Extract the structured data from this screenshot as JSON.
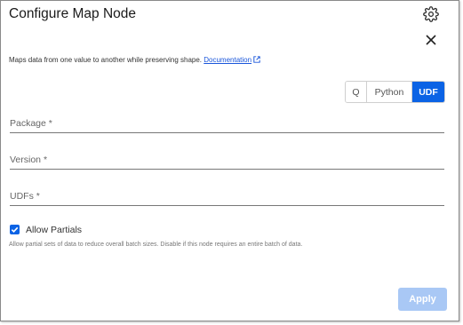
{
  "dialog": {
    "title": "Configure Map Node",
    "description": "Maps data from one value to another while preserving shape.",
    "doc_link": "Documentation"
  },
  "language": {
    "options": [
      "Q",
      "Python",
      "UDF"
    ],
    "selected": "UDF"
  },
  "fields": {
    "package_label": "Package *",
    "version_label": "Version *",
    "udfs_label": "UDFs *"
  },
  "partials": {
    "label": "Allow Partials",
    "checked": true,
    "hint": "Allow partial sets of data to reduce overall batch sizes. Disable if this node requires an entire batch of data."
  },
  "actions": {
    "apply_label": "Apply",
    "apply_enabled": false
  },
  "icons": {
    "settings": "gear-icon",
    "close": "close-icon",
    "external_link": "external-link-icon",
    "check": "check-icon"
  },
  "colors": {
    "accent": "#0b63e5",
    "apply_disabled": "#a9c8f5",
    "link": "#1a56db"
  }
}
